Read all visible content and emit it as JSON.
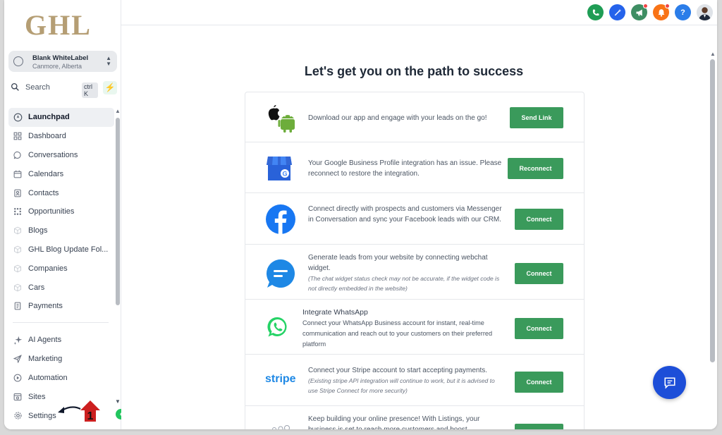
{
  "brand": {
    "logo_text": "GHL"
  },
  "account": {
    "name": "Blank WhiteLabel",
    "location": "Canmore, Alberta"
  },
  "search": {
    "label": "Search",
    "shortcut": "ctrl K"
  },
  "nav": [
    {
      "label": "Launchpad",
      "icon": "rocket-icon",
      "active": true
    },
    {
      "label": "Dashboard",
      "icon": "grid-icon"
    },
    {
      "label": "Conversations",
      "icon": "chat-bubble-icon"
    },
    {
      "label": "Calendars",
      "icon": "calendar-icon"
    },
    {
      "label": "Contacts",
      "icon": "contact-book-icon"
    },
    {
      "label": "Opportunities",
      "icon": "pipeline-icon"
    },
    {
      "label": "Blogs",
      "icon": "cube-icon"
    },
    {
      "label": "GHL Blog Update Fol...",
      "icon": "cube-icon"
    },
    {
      "label": "Companies",
      "icon": "cube-icon"
    },
    {
      "label": "Cars",
      "icon": "cube-icon"
    },
    {
      "label": "Payments",
      "icon": "receipt-icon"
    }
  ],
  "nav_bottom": [
    {
      "label": "AI Agents",
      "icon": "sparkle-icon"
    },
    {
      "label": "Marketing",
      "icon": "send-icon"
    },
    {
      "label": "Automation",
      "icon": "play-circle-icon"
    },
    {
      "label": "Sites",
      "icon": "browser-icon"
    },
    {
      "label": "Settings",
      "icon": "gear-icon"
    }
  ],
  "annotation": {
    "number": "1",
    "color": "#cc1f1f"
  },
  "topbar": {
    "icons": [
      {
        "name": "phone-icon",
        "color": "#1f9d55"
      },
      {
        "name": "magic-icon",
        "color": "#2563eb"
      },
      {
        "name": "megaphone-icon",
        "color": "#3e8e63"
      },
      {
        "name": "bell-icon",
        "color": "#f97316"
      },
      {
        "name": "help-icon",
        "color": "#2b7de9",
        "label": "?"
      }
    ]
  },
  "main": {
    "heading": "Let's get you on the path to success",
    "tasks": [
      {
        "icon": "mobile-apps-icon",
        "text": "Download our app and engage with your leads on the go!",
        "button": "Send Link"
      },
      {
        "icon": "google-business-icon",
        "text": "Your Google Business Profile integration has an issue. Please reconnect to restore the integration.",
        "button": "Reconnect"
      },
      {
        "icon": "facebook-icon",
        "text": "Connect directly with prospects and customers via Messenger in Conversation and sync your Facebook leads with our CRM.",
        "button": "Connect"
      },
      {
        "icon": "webchat-icon",
        "text": "Generate leads from your website by connecting webchat widget.",
        "note": "(The chat widget status check may not be accurate, if the widget code is not directly embedded in the website)",
        "button": "Connect"
      },
      {
        "icon": "whatsapp-icon",
        "title": "Integrate WhatsApp",
        "text": "Connect your WhatsApp Business account for instant, real-time communication and reach out to your customers on their preferred platform",
        "button": "Connect"
      },
      {
        "icon": "stripe-icon",
        "icon_text": "stripe",
        "text": "Connect your Stripe account to start accepting payments.",
        "note": "(Existing stripe API integration will continue to work, but it is advised to use Stripe Connect for more security)",
        "button": "Connect"
      },
      {
        "icon": "listings-icon",
        "text": "Keep building your online presence! With Listings, your business is set to reach more customers and boost"
      }
    ]
  },
  "colors": {
    "primary_button": "#3a9a5b",
    "accent_green": "#22c55e",
    "chat_fab": "#1d4ed8"
  }
}
